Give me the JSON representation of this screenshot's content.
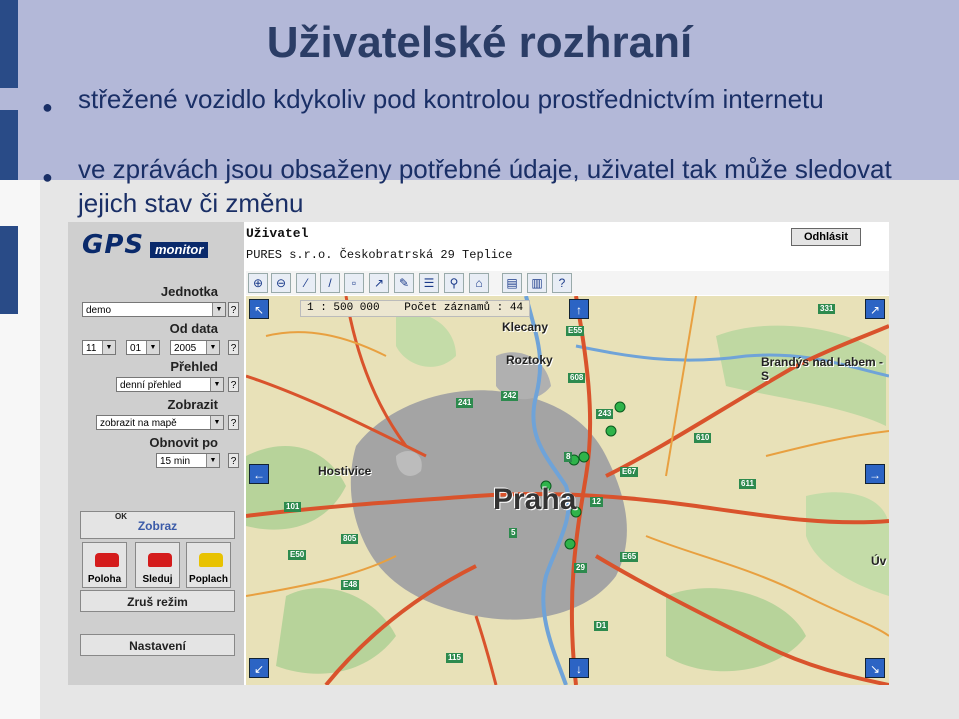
{
  "slide": {
    "title": "Uživatelské rozhraní",
    "bullets": [
      "střežené vozidlo kdykoliv pod kontrolou prostřednictvím internetu",
      "ve zprávách jsou obsaženy potřebné údaje, uživatel tak může sledovat jejich stav či změnu"
    ]
  },
  "app": {
    "logo_main": "GPS",
    "logo_sub": "monitor",
    "header": {
      "title": "Uživatel",
      "subtitle": "PURES s.r.o. Českobratrská 29 Teplice",
      "logout_label": "Odhlásit"
    },
    "form": {
      "unit_label": "Jednotka",
      "unit_value": "demo",
      "from_date_label": "Od data",
      "day_value": "11",
      "month_value": "01",
      "year_value": "2005",
      "overview_label": "Přehled",
      "overview_value": "denní přehled",
      "display_label": "Zobrazit",
      "display_value": "zobrazit na mapě",
      "refresh_label": "Obnovit po",
      "refresh_value": "15 min",
      "help_glyph": "?"
    },
    "buttons": {
      "show_ok": "OK",
      "show_label": "Zobraz",
      "position": "Poloha",
      "track": "Sleduj",
      "alarm": "Poplach",
      "cancel_mode": "Zruš režim",
      "settings": "Nastavení"
    },
    "map": {
      "scale": "1 : 500 000",
      "records": "Počet záznamů : 44",
      "city": "Praha",
      "places": [
        "Klecany",
        "Roztoky",
        "Brandýs nad Labem - S",
        "Hostivice",
        "Úv"
      ],
      "roads": [
        "241",
        "331",
        "E55",
        "608",
        "242",
        "243",
        "610",
        "611",
        "E50",
        "805",
        "E48",
        "E65",
        "115",
        "D1",
        "101",
        "E67",
        "12",
        "29",
        "8",
        "5"
      ]
    },
    "toolbar_icons": [
      "zoom-in-icon",
      "zoom-out-icon",
      "pan-icon",
      "measure-icon",
      "select-icon",
      "route-icon",
      "edit-icon",
      "layers-icon",
      "search-icon",
      "home-icon",
      "print-icon",
      "report-icon",
      "help-icon"
    ]
  }
}
